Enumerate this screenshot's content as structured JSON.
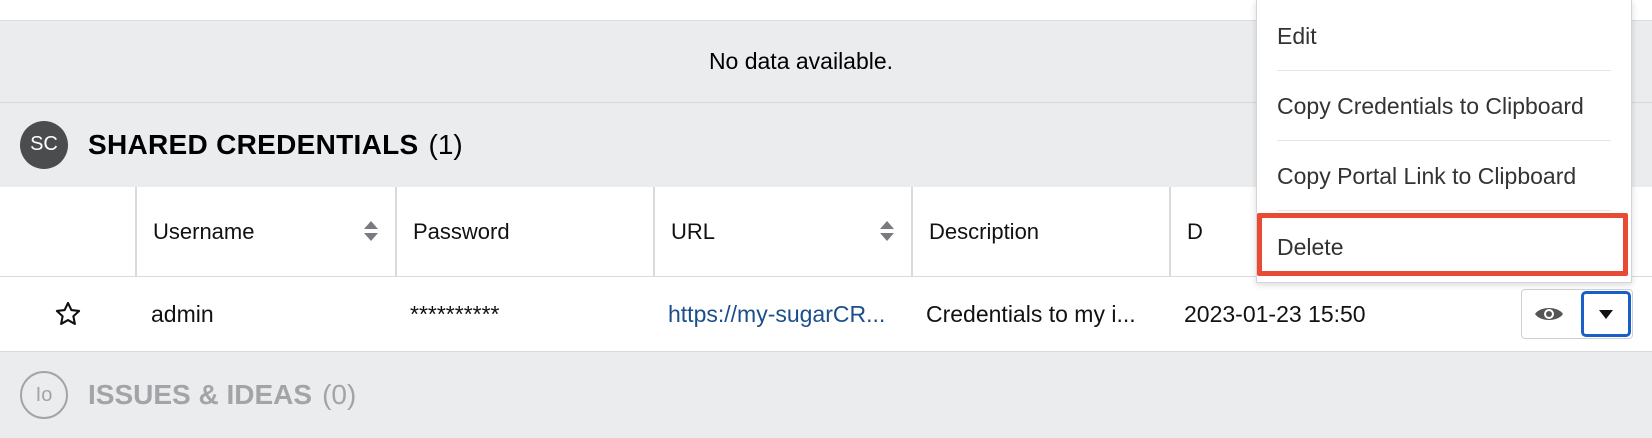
{
  "empty_state": {
    "text": "No data available."
  },
  "shared_credentials": {
    "avatar": "SC",
    "title": "SHARED CREDENTIALS",
    "count": "(1)",
    "columns": [
      "Username",
      "Password",
      "URL",
      "Description",
      "D"
    ],
    "row": {
      "username": "admin",
      "password": "**********",
      "url": "https://my-sugarCR...",
      "description": "Credentials to my i...",
      "date": "2023-01-23 15:50"
    }
  },
  "issues": {
    "avatar": "Io",
    "title": "ISSUES & IDEAS",
    "count": "(0)"
  },
  "menu": {
    "items": [
      "Edit",
      "Copy Credentials to Clipboard",
      "Copy Portal Link to Clipboard",
      "Delete"
    ]
  },
  "colors": {
    "accent": "#1a5fc7",
    "highlight": "#e84a34",
    "link": "#1b4f8a"
  },
  "icons": {
    "favorite": "star-outline-icon",
    "preview": "eye-icon",
    "actions": "caret-down-icon",
    "sort": "sort-icon"
  }
}
